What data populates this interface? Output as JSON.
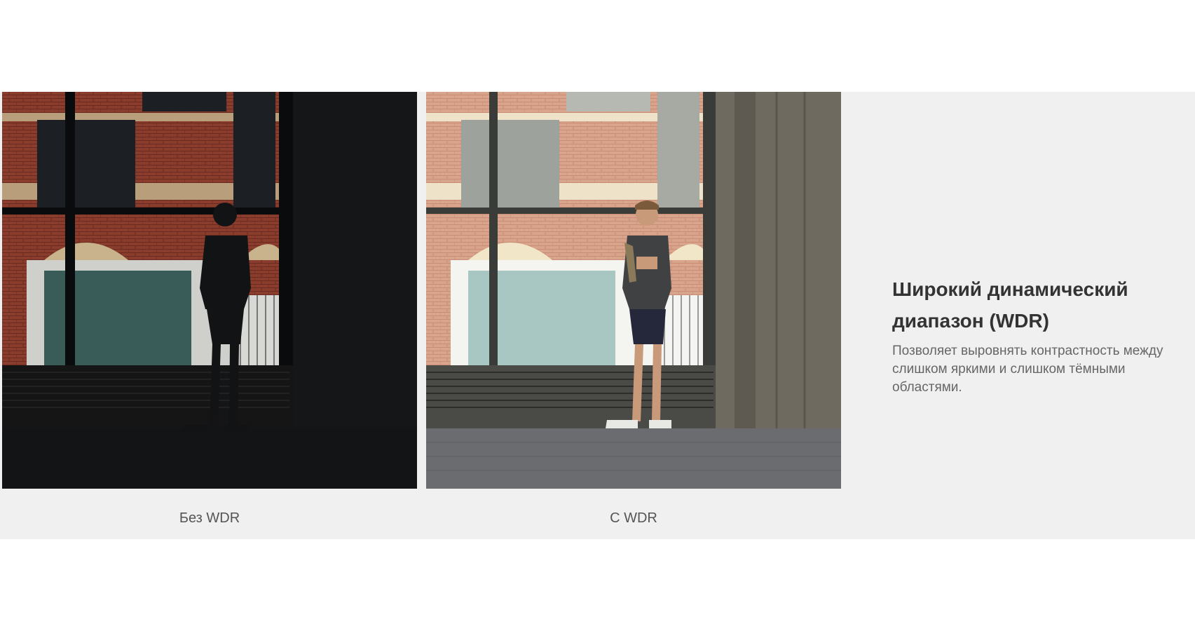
{
  "comparison": {
    "left_caption": "Без WDR",
    "right_caption": "С WDR"
  },
  "feature": {
    "title": "Широкий динамический диапазон (WDR)",
    "description": "Позволяет выровнять контрастность между слишком яркими и слишком тёмными областями."
  },
  "colors": {
    "band_background": "#f0f0f0",
    "title_color": "#333333",
    "text_color": "#666666"
  }
}
